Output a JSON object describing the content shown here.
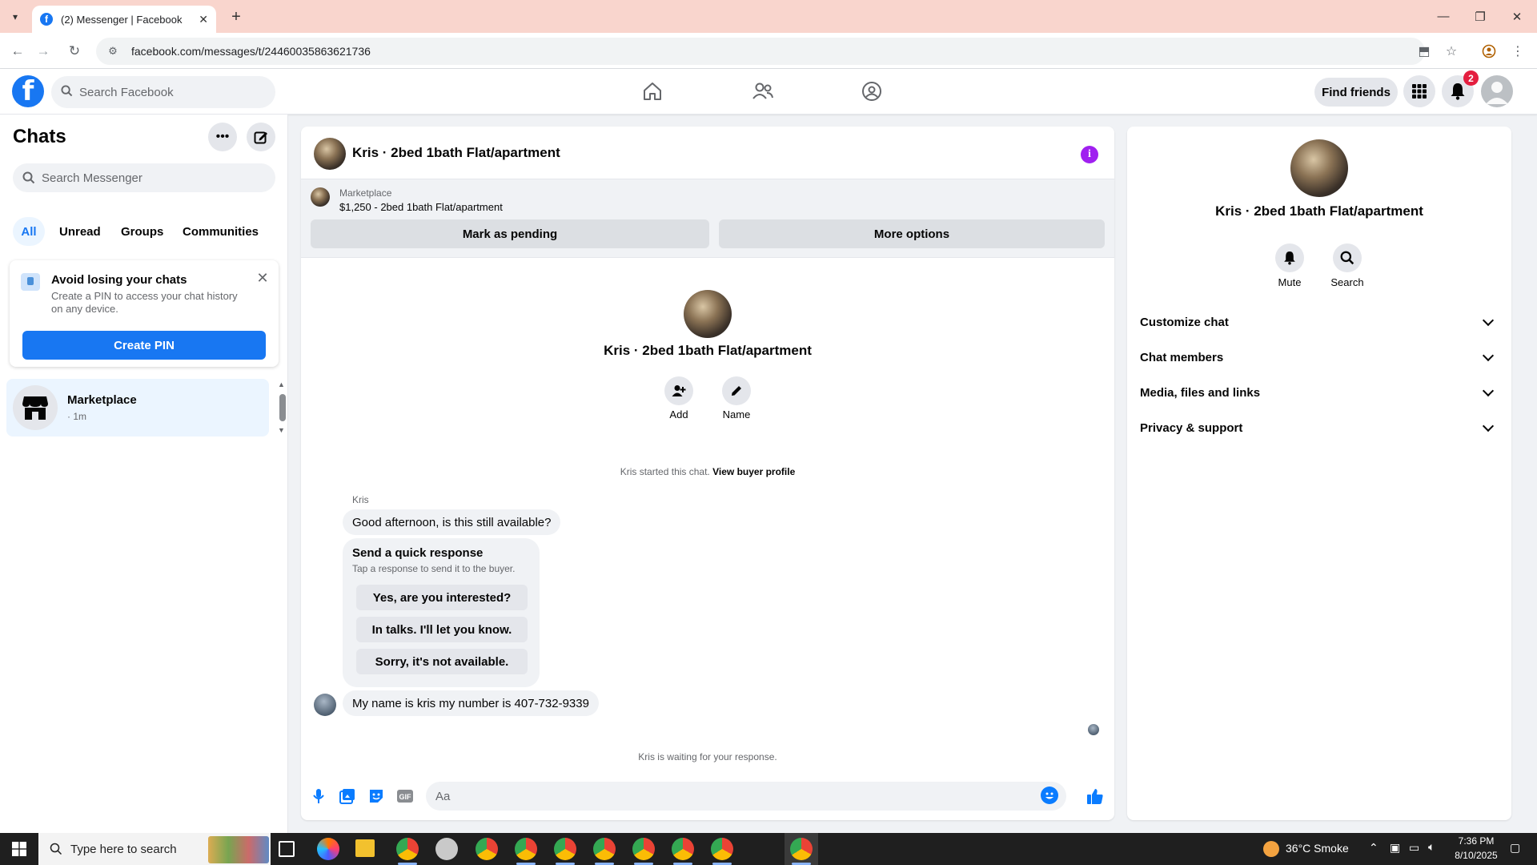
{
  "browser": {
    "tab_title": "(2) Messenger | Facebook",
    "url": "facebook.com/messages/t/24460035863621736"
  },
  "fbnav": {
    "search_placeholder": "Search Facebook",
    "find_friends": "Find friends",
    "notification_count": "2"
  },
  "sidebar": {
    "title": "Chats",
    "search_placeholder": "Search Messenger",
    "tabs": [
      {
        "label": "All",
        "active": true
      },
      {
        "label": "Unread"
      },
      {
        "label": "Groups"
      },
      {
        "label": "Communities"
      }
    ],
    "pin_card": {
      "title": "Avoid losing your chats",
      "description": "Create a PIN to access your chat history on any device.",
      "button": "Create PIN"
    },
    "chats": [
      {
        "name": "Marketplace",
        "time": "· 1m"
      }
    ]
  },
  "conversation": {
    "title": "Kris · 2bed 1bath Flat/apartment",
    "marketplace_label": "Marketplace",
    "listing": "$1,250 - 2bed 1bath Flat/apartment",
    "mark_pending": "Mark as pending",
    "more_options": "More options",
    "intro_name": "Kris · 2bed 1bath Flat/apartment",
    "actions": [
      {
        "label": "Add",
        "icon": "add-person-icon"
      },
      {
        "label": "Name",
        "icon": "pencil-icon"
      }
    ],
    "started_note": "Kris started this chat.",
    "view_buyer_profile": "View buyer profile",
    "sender": "Kris",
    "message_1": "Good afternoon, is this still available?",
    "quick_title": "Send a quick response",
    "quick_desc": "Tap a response to send it to the buyer.",
    "quick_replies": [
      "Yes, are you interested?",
      "In talks. I'll let you know.",
      "Sorry, it's not available."
    ],
    "message_2": "My name is kris my number is 407-732-9339",
    "waiting_note": "Kris is waiting for your response.",
    "composer_placeholder": "Aa"
  },
  "details": {
    "name": "Kris · 2bed 1bath Flat/apartment",
    "actions": [
      {
        "label": "Mute",
        "icon": "bell-icon"
      },
      {
        "label": "Search",
        "icon": "search-icon"
      }
    ],
    "sections": [
      "Customize chat",
      "Chat members",
      "Media, files and links",
      "Privacy & support"
    ]
  },
  "taskbar": {
    "search_placeholder": "Type here to search",
    "weather": "36°C  Smoke",
    "time": "7:36 PM",
    "date": "8/10/2025"
  },
  "colors": {
    "brand": "#1877f2",
    "messenger_blue": "#0a7cff",
    "info_purple": "#a020f0",
    "badge_red": "#e41e3f"
  }
}
